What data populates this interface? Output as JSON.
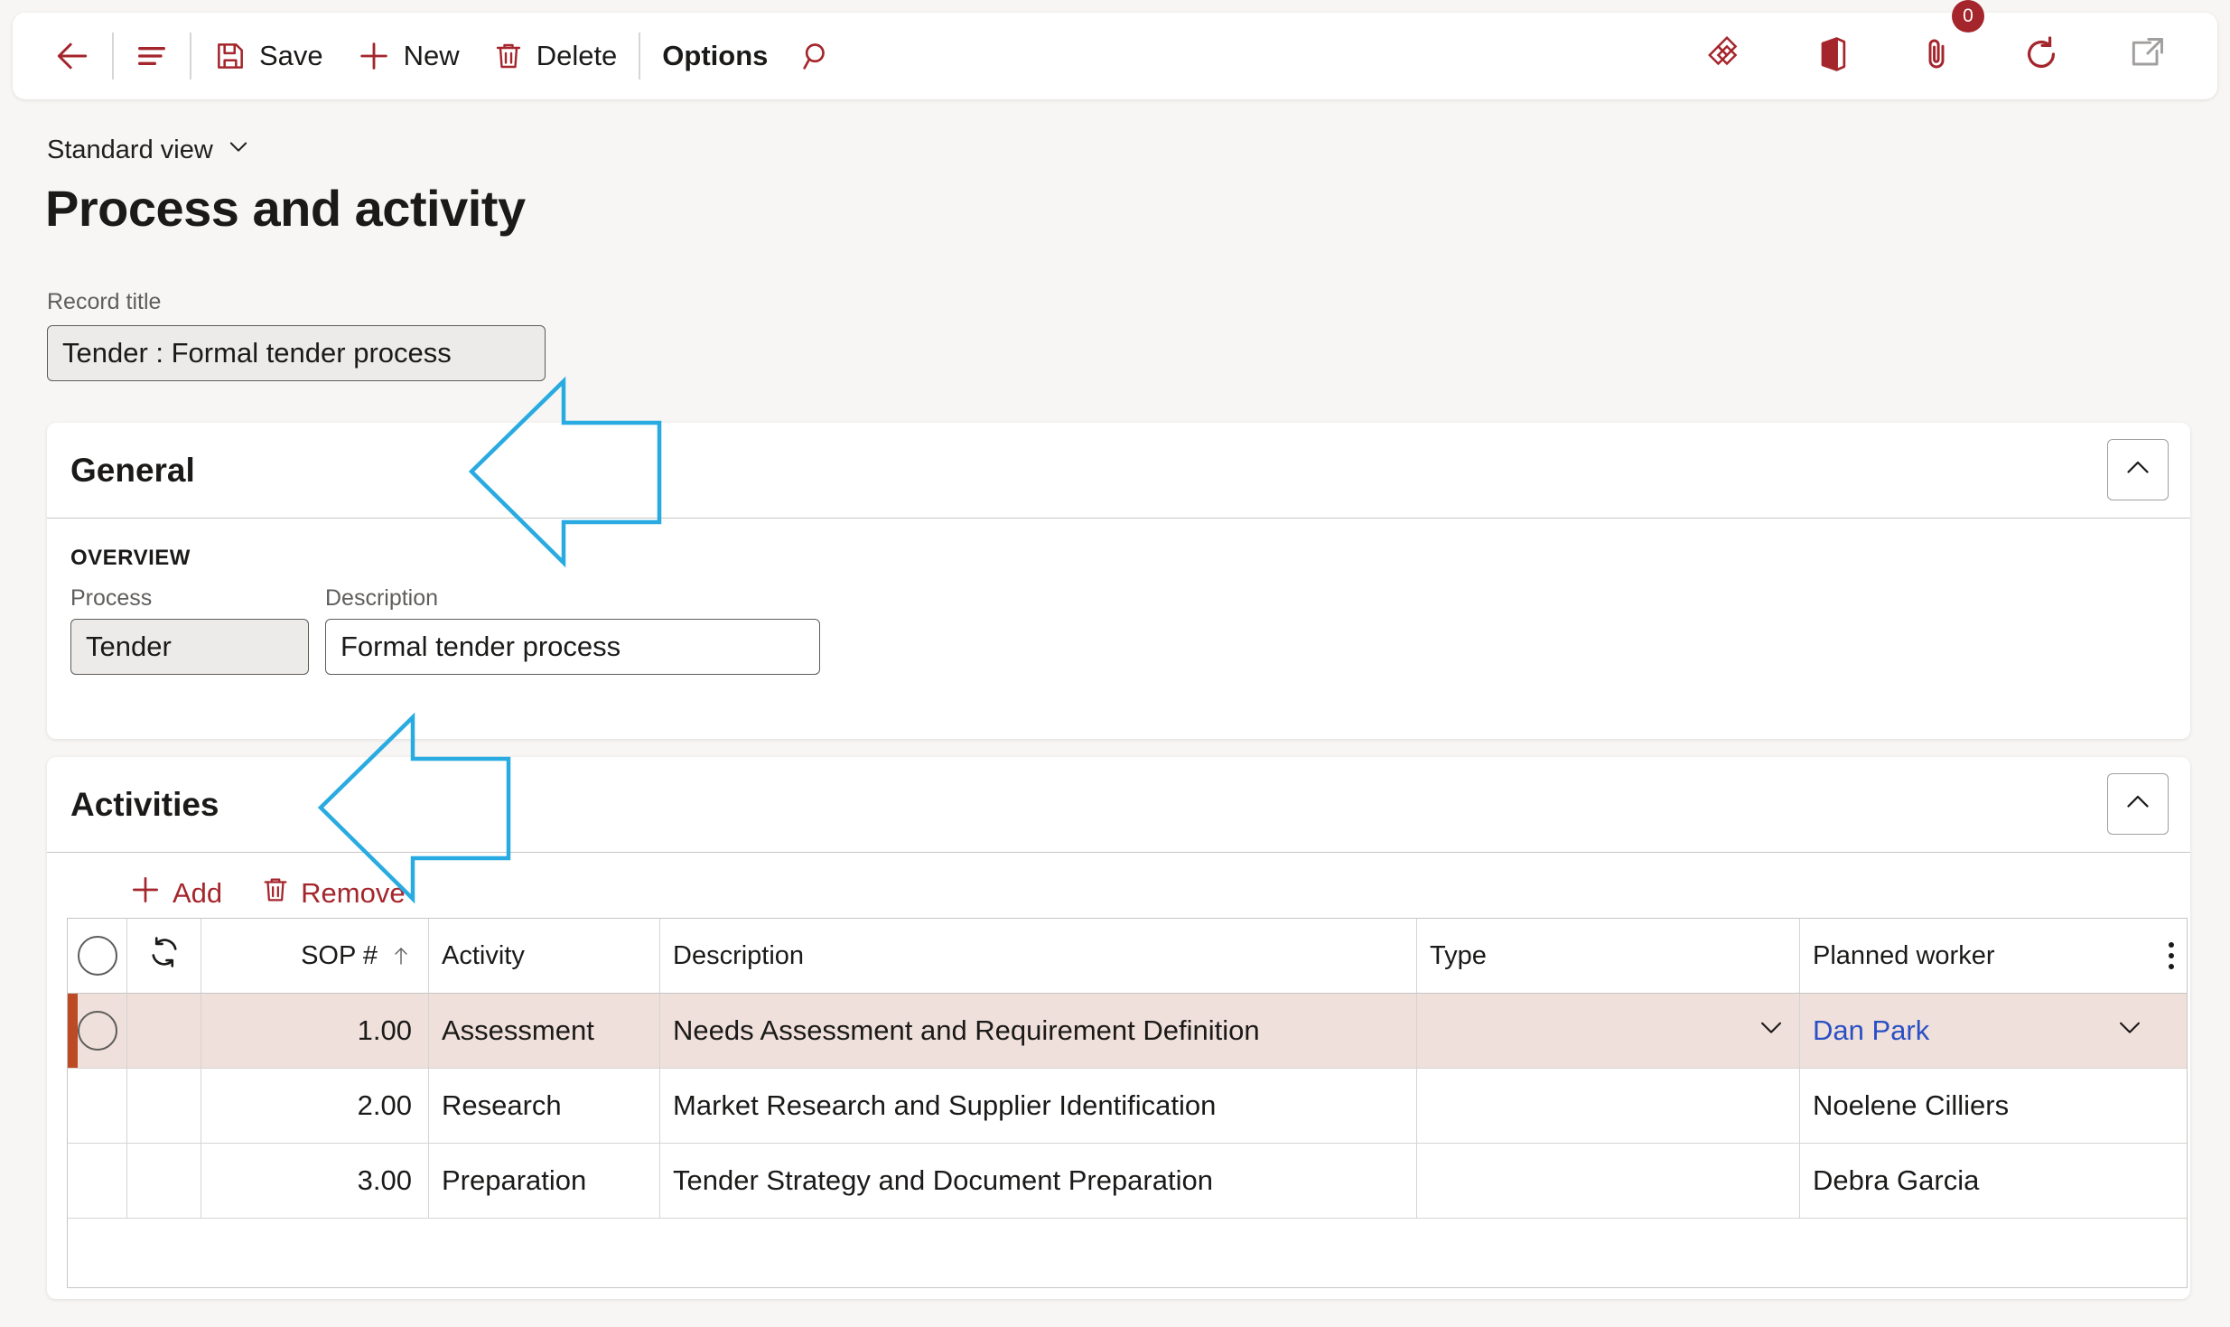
{
  "toolbar": {
    "back_icon": "arrow-left-icon",
    "menu_icon": "hamburger-menu-icon",
    "save_label": "Save",
    "save_icon": "save-disk-icon",
    "new_label": "New",
    "new_icon": "plus-icon",
    "delete_label": "Delete",
    "delete_icon": "trash-icon",
    "options_label": "Options",
    "search_icon": "search-icon",
    "right_icons": [
      {
        "name": "flow-diamond-icon"
      },
      {
        "name": "office-apps-icon"
      },
      {
        "name": "attachment-paperclip-icon",
        "badge": "0"
      },
      {
        "name": "refresh-icon"
      },
      {
        "name": "open-in-new-window-icon"
      }
    ]
  },
  "header": {
    "view_name": "Standard view",
    "view_chevron": "chevron-down-icon",
    "title": "Process and activity",
    "record_title_label": "Record title",
    "record_title_value": "Tender : Formal tender process"
  },
  "general": {
    "title": "General",
    "collapse_icon": "chevron-up-icon",
    "overview_label": "OVERVIEW",
    "process_label": "Process",
    "process_value": "Tender",
    "description_label": "Description",
    "description_value": "Formal tender process"
  },
  "activities": {
    "title": "Activities",
    "collapse_icon": "chevron-up-icon",
    "add_label": "Add",
    "add_icon": "plus-icon",
    "remove_label": "Remove",
    "remove_icon": "trash-icon",
    "grid": {
      "select_all_icon": "circle-select-icon",
      "refresh_icon": "refresh-rows-icon",
      "kebab_icon": "more-options-icon",
      "sort_icon": "sort-ascending-arrow-icon",
      "columns": [
        {
          "key": "sop",
          "label": "SOP #",
          "sorted": "ascending"
        },
        {
          "key": "activity",
          "label": "Activity"
        },
        {
          "key": "description",
          "label": "Description"
        },
        {
          "key": "type",
          "label": "Type"
        },
        {
          "key": "worker",
          "label": "Planned worker"
        }
      ],
      "rows": [
        {
          "selected": true,
          "sop": "1.00",
          "activity": "Assessment",
          "description": "Needs Assessment and Requirement Definition",
          "type": "",
          "worker": "Dan Park"
        },
        {
          "selected": false,
          "sop": "2.00",
          "activity": "Research",
          "description": "Market Research and Supplier Identification",
          "type": "",
          "worker": "Noelene Cilliers"
        },
        {
          "selected": false,
          "sop": "3.00",
          "activity": "Preparation",
          "description": "Tender Strategy and Document Preparation",
          "type": "",
          "worker": "Debra Garcia"
        }
      ]
    }
  },
  "annotations": [
    {
      "name": "arrow-pointing-to-general",
      "shape": "left-arrow-outline",
      "color": "#29ABE2"
    },
    {
      "name": "arrow-pointing-to-activities",
      "shape": "left-arrow-outline",
      "color": "#29ABE2"
    }
  ],
  "colors": {
    "accent": "#A4262C",
    "selected_row_bg": "#EFE0DB",
    "selected_row_marker": "#BC4A24",
    "link": "#2A4FC4",
    "annotation": "#29ABE2",
    "page_bg": "#F7F6F4"
  }
}
